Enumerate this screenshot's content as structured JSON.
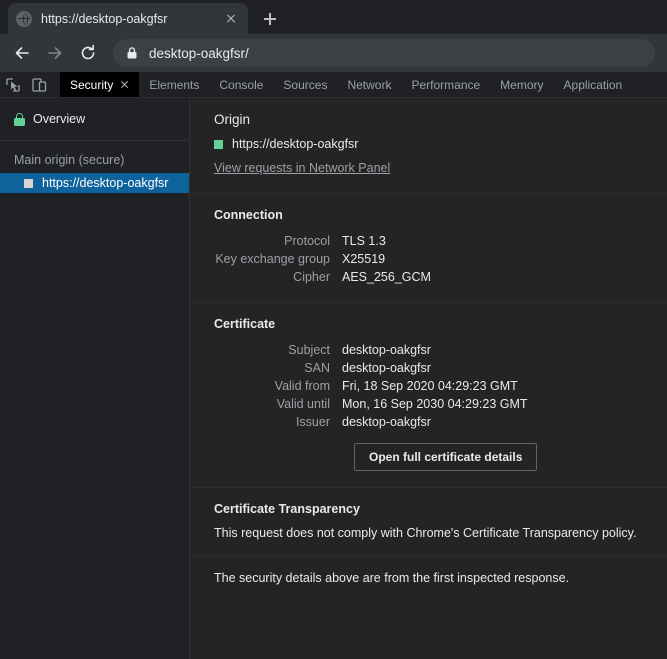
{
  "browser": {
    "tab": {
      "title": "https://desktop-oakgfsr",
      "favicon_icon": "globe-icon",
      "close_icon": "close-icon"
    },
    "new_tab_icon": "plus-icon",
    "toolbar": {
      "back_icon": "arrow-left-icon",
      "forward_icon": "arrow-right-icon",
      "reload_icon": "reload-icon",
      "lock_icon": "lock-icon",
      "url": "desktop-oakgfsr/"
    }
  },
  "devtools": {
    "inspect_icon": "inspect-element-icon",
    "device_toolbar_icon": "device-toggle-icon",
    "tabs": [
      {
        "label": "Security",
        "active": true,
        "closable": true
      },
      {
        "label": "Elements",
        "active": false,
        "closable": false
      },
      {
        "label": "Console",
        "active": false,
        "closable": false
      },
      {
        "label": "Sources",
        "active": false,
        "closable": false
      },
      {
        "label": "Network",
        "active": false,
        "closable": false
      },
      {
        "label": "Performance",
        "active": false,
        "closable": false
      },
      {
        "label": "Memory",
        "active": false,
        "closable": false
      },
      {
        "label": "Application",
        "active": false,
        "closable": false
      }
    ]
  },
  "sidebar": {
    "overview": {
      "label": "Overview",
      "icon": "lock-icon",
      "state_color": "#63d297"
    },
    "group_title": "Main origin (secure)",
    "origins": [
      {
        "label": "https://desktop-oakgfsr",
        "selected": true,
        "badge_color": "#9aa0a6"
      }
    ],
    "selected_color": "#0e639c"
  },
  "main": {
    "origin": {
      "title": "Origin",
      "url": "https://desktop-oakgfsr",
      "badge_color": "#63d297",
      "network_link": "View requests in Network Panel"
    },
    "connection": {
      "title": "Connection",
      "rows": [
        {
          "key": "Protocol",
          "value": "TLS 1.3"
        },
        {
          "key": "Key exchange group",
          "value": "X25519"
        },
        {
          "key": "Cipher",
          "value": "AES_256_GCM"
        }
      ]
    },
    "certificate": {
      "title": "Certificate",
      "rows": [
        {
          "key": "Subject",
          "value": "desktop-oakgfsr"
        },
        {
          "key": "SAN",
          "value": "desktop-oakgfsr"
        },
        {
          "key": "Valid from",
          "value": "Fri, 18 Sep 2020 04:29:23 GMT"
        },
        {
          "key": "Valid until",
          "value": "Mon, 16 Sep 2030 04:29:23 GMT"
        },
        {
          "key": "Issuer",
          "value": "desktop-oakgfsr"
        }
      ],
      "button_label": "Open full certificate details"
    },
    "transparency": {
      "title": "Certificate Transparency",
      "body": "This request does not comply with Chrome's Certificate Transparency policy."
    },
    "footer_note": "The security details above are from the first inspected response."
  },
  "colors": {
    "chrome_bg": "#323639",
    "tabstrip_bg": "#202124",
    "devtools_bg": "#202124",
    "panel_bg": "#242424",
    "accent_blue": "#0e639c",
    "secure_green": "#63d297",
    "text_primary": "#e8eaed",
    "text_secondary": "#9aa0a6"
  }
}
